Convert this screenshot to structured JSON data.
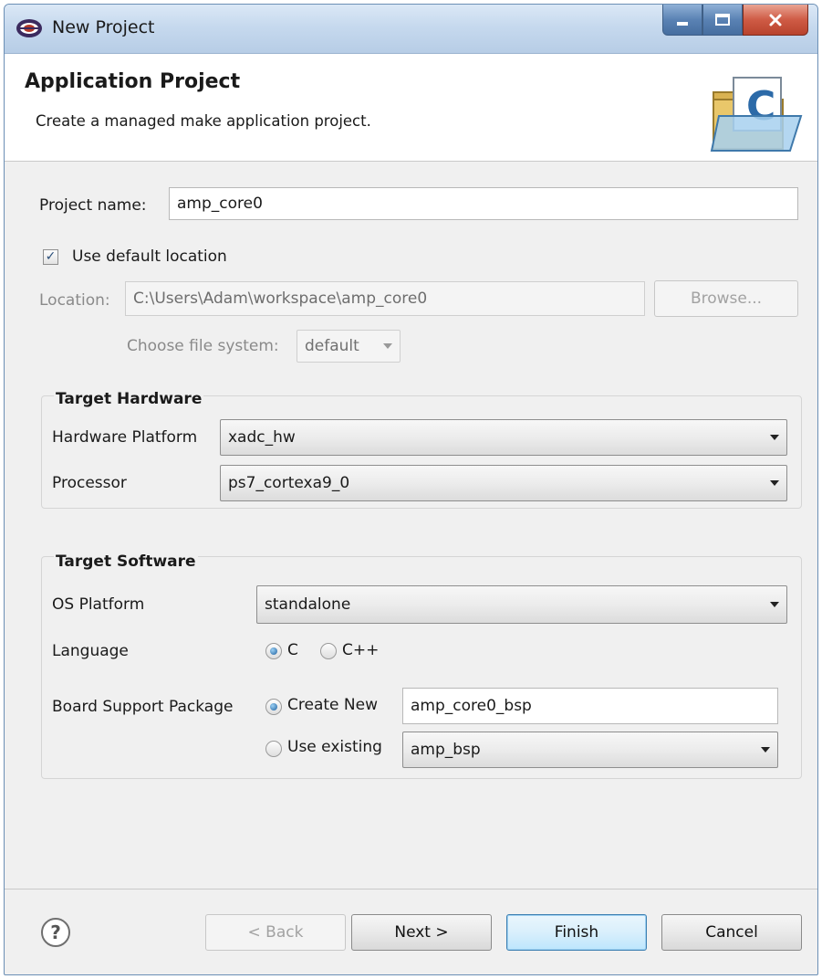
{
  "window": {
    "title": "New Project"
  },
  "banner": {
    "title": "Application Project",
    "description": "Create a managed make application project.",
    "icon_letter": "C"
  },
  "project": {
    "name_label": "Project name:",
    "name_value": "amp_core0",
    "use_default_location_label": "Use default location",
    "use_default_location_checked": true,
    "location_label": "Location:",
    "location_value": "C:\\Users\\Adam\\workspace\\amp_core0",
    "browse_label": "Browse...",
    "file_system_label": "Choose file system:",
    "file_system_value": "default"
  },
  "target_hardware": {
    "title": "Target Hardware",
    "platform_label": "Hardware Platform",
    "platform_value": "xadc_hw",
    "processor_label": "Processor",
    "processor_value": "ps7_cortexa9_0"
  },
  "target_software": {
    "title": "Target Software",
    "os_label": "OS Platform",
    "os_value": "standalone",
    "language_label": "Language",
    "language_options": [
      "C",
      "C++"
    ],
    "language_selected": "C",
    "bsp_label": "Board Support Package",
    "bsp_create_label": "Create New",
    "bsp_create_value": "amp_core0_bsp",
    "bsp_existing_label": "Use existing",
    "bsp_existing_value": "amp_bsp",
    "bsp_selected": "Create New"
  },
  "footer": {
    "help_symbol": "?",
    "back_label": "< Back",
    "next_label": "Next >",
    "finish_label": "Finish",
    "cancel_label": "Cancel"
  },
  "colors": {
    "accent": "#3c7fb1",
    "close_button": "#cf5b45",
    "title_bar": "#c6d9ee"
  },
  "icons": [
    "eclipse-app-icon",
    "minimize-icon",
    "maximize-icon",
    "close-icon",
    "c-project-folder-icon",
    "help-icon",
    "dropdown-arrow-icon"
  ]
}
